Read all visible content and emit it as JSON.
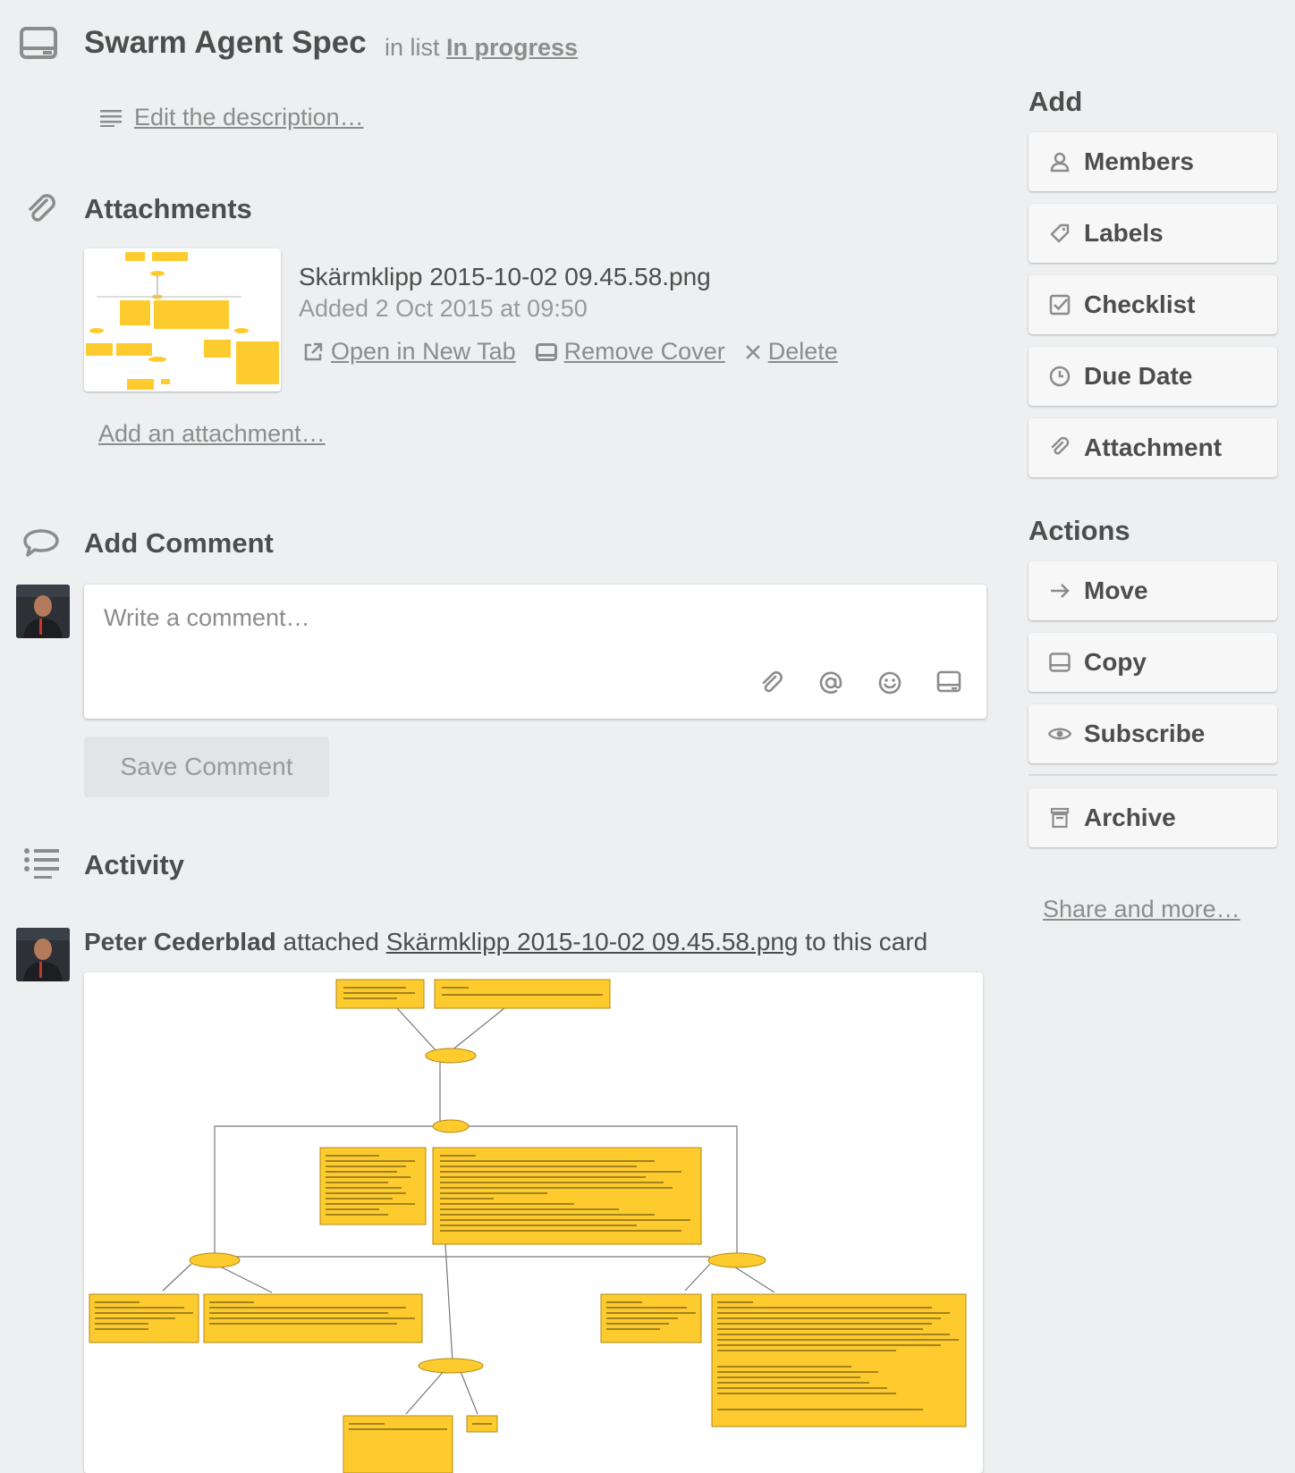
{
  "card": {
    "title": "Swarm Agent Spec",
    "in_list_prefix": "in list",
    "list_name": "In progress",
    "edit_description": "Edit the description…"
  },
  "attachments": {
    "title": "Attachments",
    "file_name": "Skärmklipp 2015-10-02 09.45.58.png",
    "added": "Added 2 Oct 2015 at 09:50",
    "open_new_tab": "Open in New Tab",
    "remove_cover": "Remove Cover",
    "delete": "Delete",
    "add_attachment": "Add an attachment…"
  },
  "comment": {
    "title": "Add Comment",
    "placeholder": "Write a comment…",
    "save_button": "Save Comment"
  },
  "activity": {
    "title": "Activity",
    "user": "Peter Cederblad",
    "verb": "attached",
    "file": "Skärmklipp 2015-10-02 09.45.58.png",
    "suffix": "to this card"
  },
  "sidebar": {
    "add_heading": "Add",
    "add_buttons": [
      {
        "label": "Members",
        "icon": "person-icon"
      },
      {
        "label": "Labels",
        "icon": "tag-icon"
      },
      {
        "label": "Checklist",
        "icon": "checkbox-icon"
      },
      {
        "label": "Due Date",
        "icon": "clock-icon"
      },
      {
        "label": "Attachment",
        "icon": "paperclip-icon"
      }
    ],
    "actions_heading": "Actions",
    "action_buttons": [
      {
        "label": "Move",
        "icon": "arrow-right-icon"
      },
      {
        "label": "Copy",
        "icon": "card-icon"
      },
      {
        "label": "Subscribe",
        "icon": "eye-icon"
      },
      {
        "label": "Archive",
        "icon": "archive-icon"
      }
    ],
    "share": "Share and more…"
  },
  "colors": {
    "background": "#edeff0",
    "text": "#4d4d4d",
    "muted": "#8c8c8c",
    "diagram_box": "#fecb2f"
  }
}
